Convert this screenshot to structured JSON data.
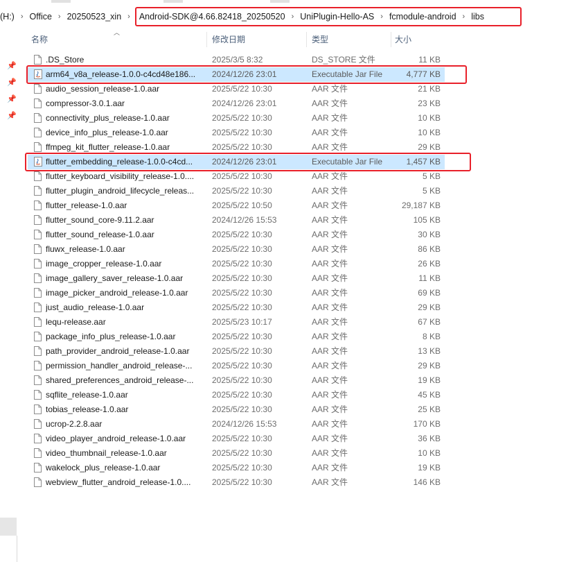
{
  "address_bar": {
    "crumbs": [
      "(H:)",
      "Office",
      "20250523_xin",
      "Android-SDK@4.66.82418_20250520",
      "UniPlugin-Hello-AS",
      "fcmodule-android",
      "libs"
    ],
    "separator": "›"
  },
  "columns": {
    "name": "名称",
    "date": "修改日期",
    "type": "类型",
    "size": "大小"
  },
  "files": [
    {
      "name": ".DS_Store",
      "date": "2025/3/5 8:32",
      "type": "DS_STORE 文件",
      "size": "11 KB",
      "icon": "file-icon",
      "selected": false
    },
    {
      "name": "arm64_v8a_release-1.0.0-c4cd48e186...",
      "date": "2024/12/26 23:01",
      "type": "Executable Jar File",
      "size": "4,777 KB",
      "icon": "jar-icon",
      "selected": true
    },
    {
      "name": "audio_session_release-1.0.aar",
      "date": "2025/5/22 10:30",
      "type": "AAR 文件",
      "size": "21 KB",
      "icon": "file-icon",
      "selected": false
    },
    {
      "name": "compressor-3.0.1.aar",
      "date": "2024/12/26 23:01",
      "type": "AAR 文件",
      "size": "23 KB",
      "icon": "file-icon",
      "selected": false
    },
    {
      "name": "connectivity_plus_release-1.0.aar",
      "date": "2025/5/22 10:30",
      "type": "AAR 文件",
      "size": "10 KB",
      "icon": "file-icon",
      "selected": false
    },
    {
      "name": "device_info_plus_release-1.0.aar",
      "date": "2025/5/22 10:30",
      "type": "AAR 文件",
      "size": "10 KB",
      "icon": "file-icon",
      "selected": false
    },
    {
      "name": "ffmpeg_kit_flutter_release-1.0.aar",
      "date": "2025/5/22 10:30",
      "type": "AAR 文件",
      "size": "29 KB",
      "icon": "file-icon",
      "selected": false
    },
    {
      "name": "flutter_embedding_release-1.0.0-c4cd...",
      "date": "2024/12/26 23:01",
      "type": "Executable Jar File",
      "size": "1,457 KB",
      "icon": "jar-icon",
      "selected": true
    },
    {
      "name": "flutter_keyboard_visibility_release-1.0....",
      "date": "2025/5/22 10:30",
      "type": "AAR 文件",
      "size": "5 KB",
      "icon": "file-icon",
      "selected": false
    },
    {
      "name": "flutter_plugin_android_lifecycle_releas...",
      "date": "2025/5/22 10:30",
      "type": "AAR 文件",
      "size": "5 KB",
      "icon": "file-icon",
      "selected": false
    },
    {
      "name": "flutter_release-1.0.aar",
      "date": "2025/5/22 10:50",
      "type": "AAR 文件",
      "size": "29,187 KB",
      "icon": "file-icon",
      "selected": false
    },
    {
      "name": "flutter_sound_core-9.11.2.aar",
      "date": "2024/12/26 15:53",
      "type": "AAR 文件",
      "size": "105 KB",
      "icon": "file-icon",
      "selected": false
    },
    {
      "name": "flutter_sound_release-1.0.aar",
      "date": "2025/5/22 10:30",
      "type": "AAR 文件",
      "size": "30 KB",
      "icon": "file-icon",
      "selected": false
    },
    {
      "name": "fluwx_release-1.0.aar",
      "date": "2025/5/22 10:30",
      "type": "AAR 文件",
      "size": "86 KB",
      "icon": "file-icon",
      "selected": false
    },
    {
      "name": "image_cropper_release-1.0.aar",
      "date": "2025/5/22 10:30",
      "type": "AAR 文件",
      "size": "26 KB",
      "icon": "file-icon",
      "selected": false
    },
    {
      "name": "image_gallery_saver_release-1.0.aar",
      "date": "2025/5/22 10:30",
      "type": "AAR 文件",
      "size": "11 KB",
      "icon": "file-icon",
      "selected": false
    },
    {
      "name": "image_picker_android_release-1.0.aar",
      "date": "2025/5/22 10:30",
      "type": "AAR 文件",
      "size": "69 KB",
      "icon": "file-icon",
      "selected": false
    },
    {
      "name": "just_audio_release-1.0.aar",
      "date": "2025/5/22 10:30",
      "type": "AAR 文件",
      "size": "29 KB",
      "icon": "file-icon",
      "selected": false
    },
    {
      "name": "lequ-release.aar",
      "date": "2025/5/23 10:17",
      "type": "AAR 文件",
      "size": "67 KB",
      "icon": "file-icon",
      "selected": false
    },
    {
      "name": "package_info_plus_release-1.0.aar",
      "date": "2025/5/22 10:30",
      "type": "AAR 文件",
      "size": "8 KB",
      "icon": "file-icon",
      "selected": false
    },
    {
      "name": "path_provider_android_release-1.0.aar",
      "date": "2025/5/22 10:30",
      "type": "AAR 文件",
      "size": "13 KB",
      "icon": "file-icon",
      "selected": false
    },
    {
      "name": "permission_handler_android_release-...",
      "date": "2025/5/22 10:30",
      "type": "AAR 文件",
      "size": "29 KB",
      "icon": "file-icon",
      "selected": false
    },
    {
      "name": "shared_preferences_android_release-...",
      "date": "2025/5/22 10:30",
      "type": "AAR 文件",
      "size": "19 KB",
      "icon": "file-icon",
      "selected": false
    },
    {
      "name": "sqflite_release-1.0.aar",
      "date": "2025/5/22 10:30",
      "type": "AAR 文件",
      "size": "45 KB",
      "icon": "file-icon",
      "selected": false
    },
    {
      "name": "tobias_release-1.0.aar",
      "date": "2025/5/22 10:30",
      "type": "AAR 文件",
      "size": "25 KB",
      "icon": "file-icon",
      "selected": false
    },
    {
      "name": "ucrop-2.2.8.aar",
      "date": "2024/12/26 15:53",
      "type": "AAR 文件",
      "size": "170 KB",
      "icon": "file-icon",
      "selected": false
    },
    {
      "name": "video_player_android_release-1.0.aar",
      "date": "2025/5/22 10:30",
      "type": "AAR 文件",
      "size": "36 KB",
      "icon": "file-icon",
      "selected": false
    },
    {
      "name": "video_thumbnail_release-1.0.aar",
      "date": "2025/5/22 10:30",
      "type": "AAR 文件",
      "size": "10 KB",
      "icon": "file-icon",
      "selected": false
    },
    {
      "name": "wakelock_plus_release-1.0.aar",
      "date": "2025/5/22 10:30",
      "type": "AAR 文件",
      "size": "19 KB",
      "icon": "file-icon",
      "selected": false
    },
    {
      "name": "webview_flutter_android_release-1.0....",
      "date": "2025/5/22 10:30",
      "type": "AAR 文件",
      "size": "146 KB",
      "icon": "file-icon",
      "selected": false
    }
  ],
  "colors": {
    "selection": "#cce8ff",
    "highlight_box": "#e8202a",
    "header_text": "#4c607a"
  },
  "nav_pins": [
    "pin-icon",
    "pin-icon",
    "pin-icon",
    "pin-icon"
  ]
}
